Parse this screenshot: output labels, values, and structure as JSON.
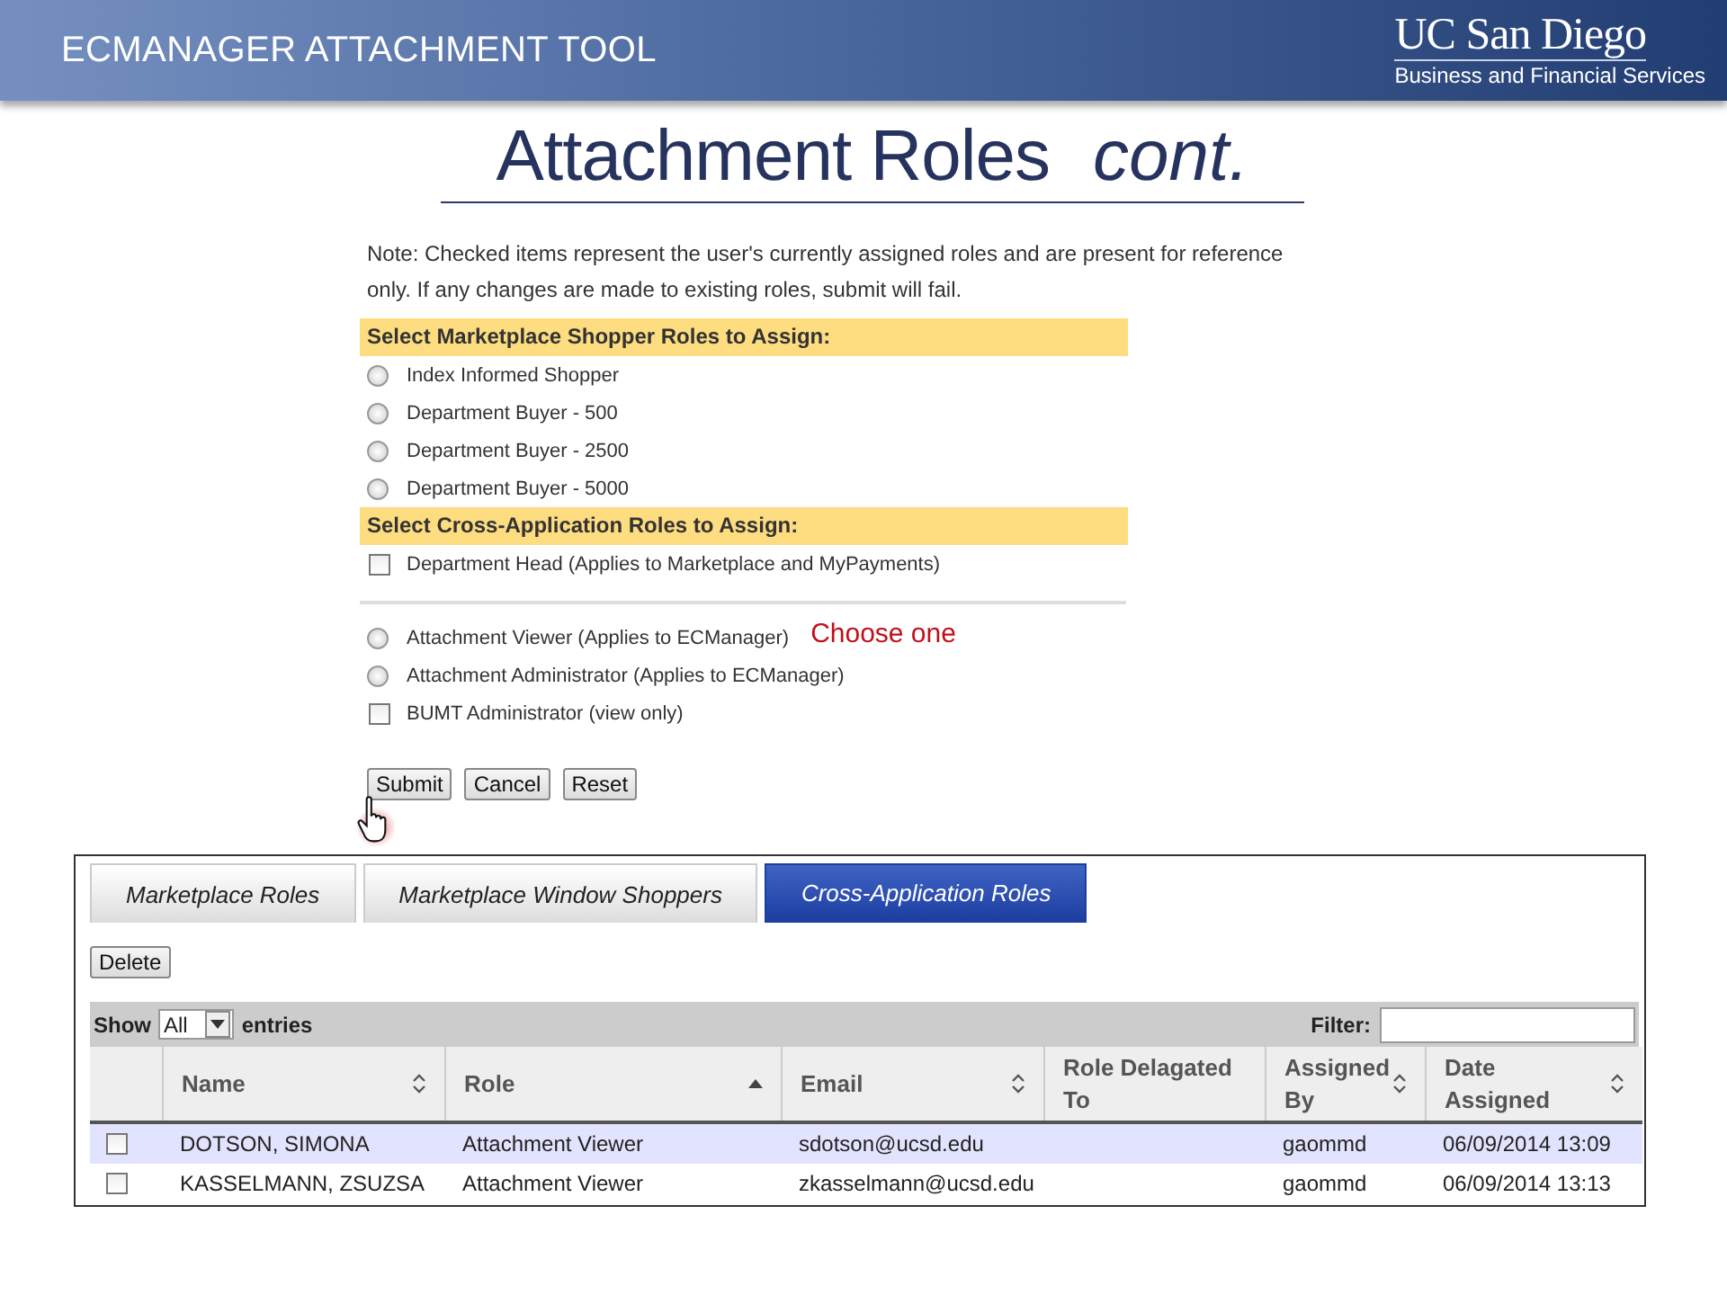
{
  "header": {
    "title": "ECMANAGER ATTACHMENT TOOL",
    "logo": {
      "name": "UC San Diego",
      "subtitle": "Business and Financial Services"
    }
  },
  "heading": {
    "text": "Attachment Roles",
    "suffix": "cont."
  },
  "form": {
    "note": "Note: Checked items represent the user's currently assigned roles and are present for reference only. If any changes are made to existing roles, submit will fail.",
    "sections": [
      {
        "title": "Select Marketplace Shopper Roles to Assign:",
        "options": [
          {
            "kind": "radio",
            "label": "Index Informed Shopper",
            "checked": false
          },
          {
            "kind": "radio",
            "label": "Department Buyer - 500",
            "checked": false
          },
          {
            "kind": "radio",
            "label": "Department Buyer - 2500",
            "checked": false
          },
          {
            "kind": "radio",
            "label": "Department Buyer - 5000",
            "checked": false
          }
        ]
      },
      {
        "title": "Select Cross-Application Roles to Assign:",
        "options": [
          {
            "kind": "checkbox",
            "label": "Department Head (Applies to Marketplace and MyPayments)",
            "checked": false
          },
          {
            "kind": "divider"
          },
          {
            "kind": "radio",
            "label": "Attachment Viewer (Applies to ECManager)",
            "checked": false,
            "callout": "Choose one"
          },
          {
            "kind": "radio",
            "label": "Attachment Administrator (Applies to ECManager)",
            "checked": false
          },
          {
            "kind": "checkbox",
            "label": "BUMT Administrator (view only)",
            "checked": false
          }
        ]
      }
    ],
    "buttons": [
      "Submit",
      "Cancel",
      "Reset"
    ]
  },
  "table": {
    "tabs": [
      {
        "label": "Marketplace Roles",
        "selected": false
      },
      {
        "label": "Marketplace Window Shoppers",
        "selected": false
      },
      {
        "label": "Cross-Application Roles",
        "selected": true
      }
    ],
    "delete_button": "Delete",
    "show_label": "Show",
    "page_size": "All",
    "entries_label": "entries",
    "filter_label": "Filter:",
    "columns": [
      {
        "label": "Name",
        "sortable": true,
        "sorted_ascending": false
      },
      {
        "label": "Role",
        "sortable": true,
        "sorted_ascending": true
      },
      {
        "label": "Email",
        "sortable": true,
        "sorted_ascending": false
      },
      {
        "label": "Role Delagated To",
        "sortable": false,
        "sorted_ascending": false
      },
      {
        "label": "Assigned By",
        "sortable": true,
        "sorted_ascending": false
      },
      {
        "label": "Date Assigned",
        "sortable": true,
        "sorted_ascending": false
      }
    ],
    "rows": [
      {
        "selected": true,
        "checked": false,
        "cells": [
          "DOTSON, SIMONA",
          "Attachment Viewer",
          "sdotson@ucsd.edu",
          "",
          "gaommd",
          "06/09/2014 13:09"
        ]
      },
      {
        "selected": false,
        "checked": false,
        "cells": [
          "KASSELMANN, ZSUZSA",
          "Attachment Viewer",
          "zkasselmann@ucsd.edu",
          "",
          "gaommd",
          "06/09/2014 13:13"
        ]
      }
    ]
  }
}
